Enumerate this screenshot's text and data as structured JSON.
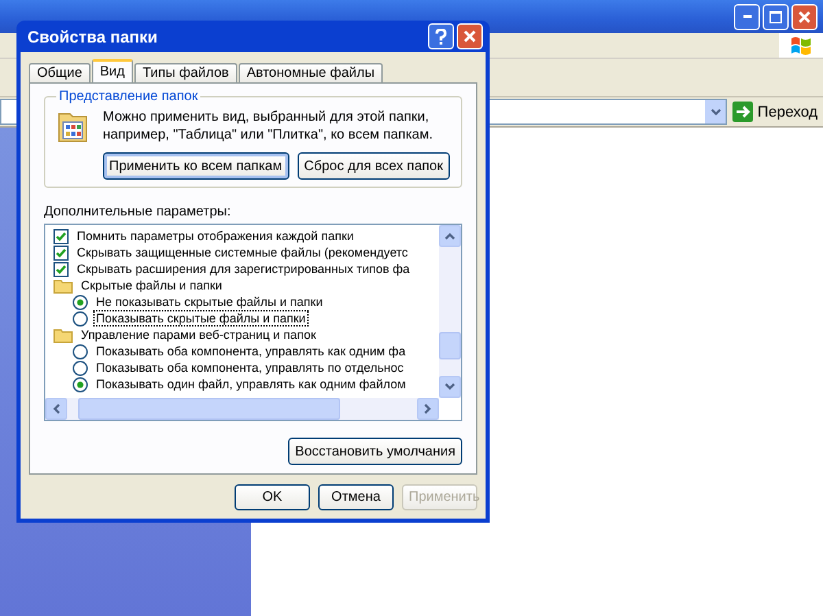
{
  "explorer": {
    "go_button": "Переход"
  },
  "dialog": {
    "title": "Свойства папки",
    "tabs": [
      {
        "label": "Общие",
        "selected": false
      },
      {
        "label": "Вид",
        "selected": true
      },
      {
        "label": "Типы файлов",
        "selected": false
      },
      {
        "label": "Автономные файлы",
        "selected": false
      }
    ],
    "folder_views": {
      "legend": "Представление папок",
      "text_lines": [
        "Можно применить вид, выбранный для этой папки,",
        "например, \"Таблица\" или \"Плитка\", ко всем папкам."
      ],
      "buttons": [
        {
          "label": "Применить ко всем папкам",
          "focused": true
        },
        {
          "label": "Сброс для всех папок",
          "focused": false
        }
      ]
    },
    "advanced": {
      "label": "Дополнительные параметры:",
      "items": [
        {
          "kind": "checkbox",
          "label": "Помнить параметры отображения каждой папки",
          "checked": true
        },
        {
          "kind": "checkbox",
          "label": "Скрывать защищенные системные файлы (рекомендуетс",
          "checked": true
        },
        {
          "kind": "checkbox",
          "label": "Скрывать расширения для зарегистрированных типов фа",
          "checked": true
        },
        {
          "kind": "group",
          "label": "Скрытые файлы и папки",
          "children": [
            {
              "kind": "radio",
              "label": "Не показывать скрытые файлы и папки",
              "checked": true,
              "focused": false
            },
            {
              "kind": "radio",
              "label": "Показывать скрытые файлы и папки",
              "checked": false,
              "focused": true
            }
          ]
        },
        {
          "kind": "group",
          "label": "Управление парами веб-страниц и папок",
          "children": [
            {
              "kind": "radio",
              "label": "Показывать оба компонента, управлять как одним фа",
              "checked": false,
              "focused": false
            },
            {
              "kind": "radio",
              "label": "Показывать оба компонента, управлять по отдельнос",
              "checked": false,
              "focused": false
            },
            {
              "kind": "radio",
              "label": "Показывать один файл, управлять как одним файлом",
              "checked": true,
              "focused": false
            }
          ]
        }
      ]
    },
    "restore_button": "Восстановить умолчания",
    "buttons": [
      {
        "label": "OK",
        "disabled": false
      },
      {
        "label": "Отмена",
        "disabled": false
      },
      {
        "label": "Применить",
        "disabled": true
      }
    ]
  }
}
